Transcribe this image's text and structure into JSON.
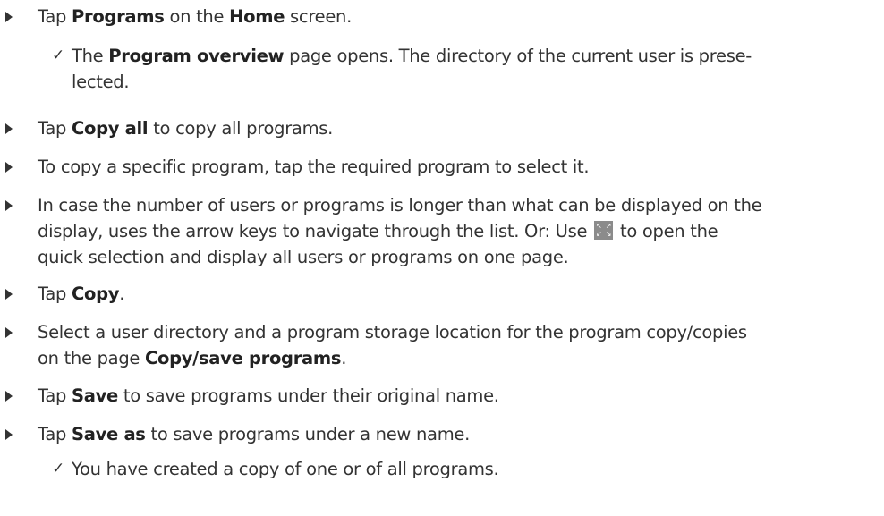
{
  "steps": [
    {
      "parts": [
        "Tap ",
        "Programs",
        " on the ",
        "Home",
        " screen."
      ]
    },
    {
      "parts": [
        "Tap ",
        "Copy all",
        " to copy all programs."
      ]
    },
    {
      "text": "To copy a specific program, tap the required program to select it."
    },
    {
      "line1": "In case the number of users or programs is longer than what can be displayed on the",
      "line2_a": "display, uses the arrow keys to navigate through the list. Or: Use",
      "line2_b": "to open the",
      "line3": "quick selection and display all users or programs on one page."
    },
    {
      "parts": [
        "Tap ",
        "Copy",
        "."
      ]
    },
    {
      "line1": "Select a user directory and a program storage location for the program copy/copies",
      "line2_a": "on the page ",
      "line2_b": "Copy/save programs",
      "line2_c": "."
    },
    {
      "parts": [
        "Tap ",
        "Save",
        " to save programs under their original name."
      ]
    },
    {
      "parts": [
        "Tap ",
        "Save as",
        " to save programs under a new name."
      ]
    }
  ],
  "results": [
    {
      "check": "✓",
      "parts": [
        "The ",
        "Program overview",
        " page opens. The directory of the current user is prese-",
        "lected."
      ]
    },
    {
      "check": "✓",
      "text": "You have created a copy of one or of all programs."
    }
  ],
  "icons": {
    "expand": "expand-icon"
  },
  "colors": {
    "text": "#333333",
    "icon_bg": "#8b8b8b"
  }
}
